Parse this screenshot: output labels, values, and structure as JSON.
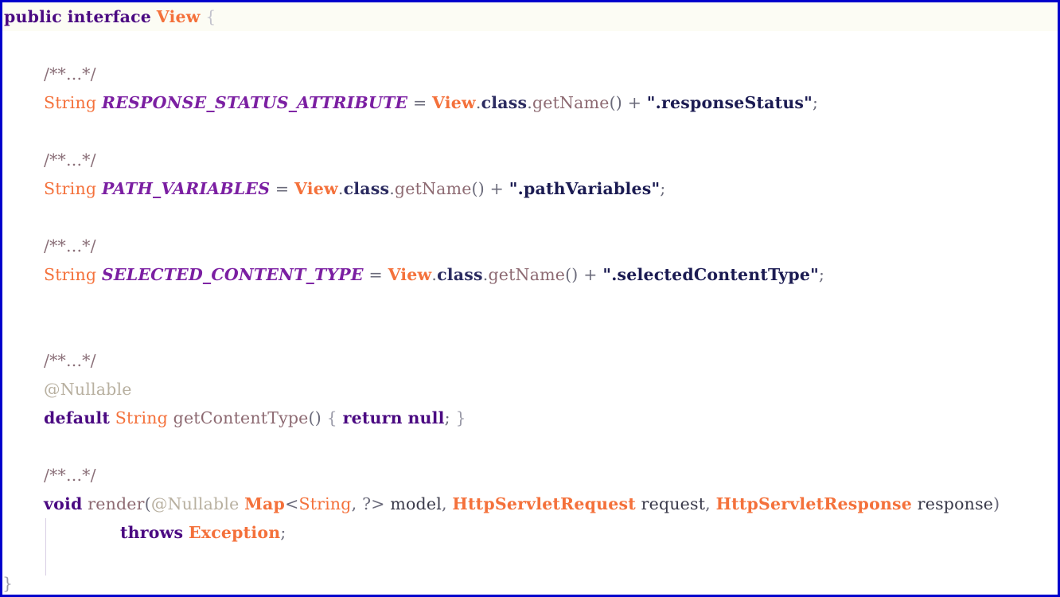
{
  "editor": {
    "language": "java",
    "border_color": "#0000cc",
    "background": "#ffffff",
    "current_line_background": "#fcfcf4"
  },
  "palette": {
    "keyword": "#4b0a82",
    "type": "#f4713b",
    "constant": "#7b1fa2",
    "method": "#8d6a72",
    "field": "#2b2b60",
    "string": "#1b1b52",
    "annotation": "#b8b0a0",
    "folded_comment": "#8a6f78",
    "parameter": "#4a4a58",
    "punctuation": "#6a6a7a",
    "brace": "#c2c2cc",
    "indent_guide": "#d9cfe4"
  },
  "code": {
    "line01": {
      "kw_public": "public",
      "sp1": " ",
      "kw_interface": "interface",
      "sp2": " ",
      "type_view": "View",
      "sp3": " ",
      "brace_open": "{"
    },
    "fold_marker": "/**...*/",
    "line03": {
      "type_string": "String",
      "sp1": " ",
      "const_name": "RESPONSE_STATUS_ATTRIBUTE",
      "eq": " = ",
      "type_view": "View",
      "dot1": ".",
      "field_class": "class",
      "dot2": ".",
      "method_getname": "getName",
      "parens": "()",
      "plus": " + ",
      "string_literal": "\".responseStatus\"",
      "semi": ";"
    },
    "line06": {
      "type_string": "String",
      "sp1": " ",
      "const_name": "PATH_VARIABLES",
      "eq": " = ",
      "type_view": "View",
      "dot1": ".",
      "field_class": "class",
      "dot2": ".",
      "method_getname": "getName",
      "parens": "()",
      "plus": " + ",
      "string_literal": "\".pathVariables\"",
      "semi": ";"
    },
    "line09": {
      "type_string": "String",
      "sp1": " ",
      "const_name": "SELECTED_CONTENT_TYPE",
      "eq": " = ",
      "type_view": "View",
      "dot1": ".",
      "field_class": "class",
      "dot2": ".",
      "method_getname": "getName",
      "parens": "()",
      "plus": " + ",
      "string_literal": "\".selectedContentType\"",
      "semi": ";"
    },
    "line13": {
      "annotation": "@Nullable"
    },
    "line14": {
      "kw_default": "default",
      "sp1": " ",
      "type_string": "String",
      "sp2": " ",
      "method_name": "getContentType",
      "parens": "()",
      "sp3": " ",
      "brace_open": "{",
      "sp4": " ",
      "kw_return": "return",
      "sp5": " ",
      "kw_null": "null",
      "semi": ";",
      "sp6": " ",
      "brace_close": "}"
    },
    "line17": {
      "kw_void": "void",
      "sp1": " ",
      "method_render": "render",
      "paren_open": "(",
      "annotation": "@Nullable",
      "sp2": " ",
      "type_map": "Map",
      "generic_open": "<",
      "type_string": "String",
      "comma1": ", ",
      "wildcard": "?",
      "generic_close": ">",
      "sp3": " ",
      "param_model": "model",
      "comma2": ", ",
      "type_request": "HttpServletRequest",
      "sp4": " ",
      "param_request": "request",
      "comma3": ", ",
      "type_response": "HttpServletResponse",
      "sp5": " ",
      "param_response": "response",
      "paren_close": ")"
    },
    "line18": {
      "kw_throws": "throws",
      "sp1": " ",
      "type_exception": "Exception",
      "semi": ";"
    },
    "line20": {
      "brace_close": "}"
    }
  }
}
